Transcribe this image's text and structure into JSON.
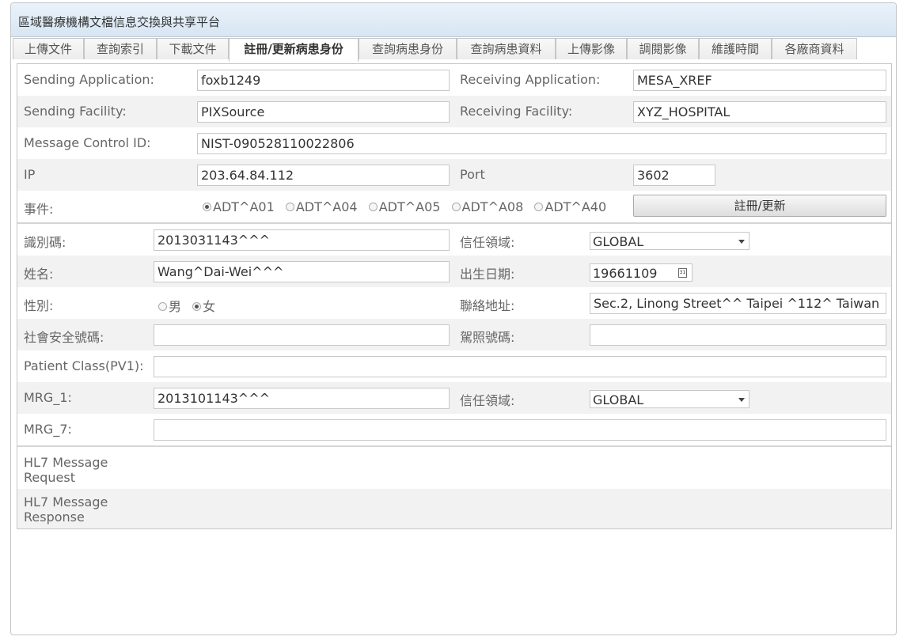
{
  "app": {
    "title": "區域醫療機構文檔信息交換與共享平台"
  },
  "tabs": [
    "上傳文件",
    "查詢索引",
    "下載文件",
    "註冊/更新病患身份",
    "查詢病患身份",
    "查詢病患資料",
    "上傳影像",
    "調閱影像",
    "維護時間",
    "各廠商資料"
  ],
  "active_tab": "註冊/更新病患身份",
  "header": {
    "sending_application_label": "Sending Application:",
    "sending_application_value": "foxb1249",
    "receiving_application_label": "Receiving Application:",
    "receiving_application_value": "MESA_XREF",
    "sending_facility_label": "Sending Facility:",
    "sending_facility_value": "PIXSource",
    "receiving_facility_label": "Receiving Facility:",
    "receiving_facility_value": "XYZ_HOSPITAL",
    "message_control_id_label": "Message Control ID:",
    "message_control_id_value": "NIST-090528110022806",
    "ip_label": "IP",
    "ip_value": "203.64.84.112",
    "port_label": "Port",
    "port_value": "3602",
    "event_label": "事件:",
    "events": [
      "ADT^A01",
      "ADT^A04",
      "ADT^A05",
      "ADT^A08",
      "ADT^A40"
    ],
    "selected_event": "ADT^A01",
    "register_button": "註冊/更新"
  },
  "patient": {
    "id_label": "識別碼:",
    "id_value": "2013031143^^^",
    "trust_domain_label": "信任領域:",
    "trust_domain_value": "GLOBAL",
    "name_label": "姓名:",
    "name_value": "Wang^Dai-Wei^^^",
    "dob_label": "出生日期:",
    "dob_value": "19661109",
    "sex_label": "性別:",
    "sex_options": [
      "男",
      "女"
    ],
    "sex_selected": "女",
    "address_label": "聯絡地址:",
    "address_value": "Sec.2, Linong Street^^ Taipei ^112^ Taiwan",
    "ssn_label": "社會安全號碼:",
    "ssn_value": "",
    "license_label": "駕照號碼:",
    "license_value": "",
    "patient_class_label": "Patient Class(PV1):",
    "patient_class_value": "",
    "mrg1_label": "MRG_1:",
    "mrg1_value": "2013101143^^^",
    "mrg1_domain_label": "信任領域:",
    "mrg1_domain_value": "GLOBAL",
    "mrg7_label": "MRG_7:",
    "mrg7_value": ""
  },
  "hl7": {
    "request_label": "HL7 Message Request",
    "response_label": "HL7 Message Response",
    "request_value": "",
    "response_value": ""
  },
  "icons": {
    "calendar": "calendar-icon",
    "dropdown": "chevron-down-icon"
  }
}
